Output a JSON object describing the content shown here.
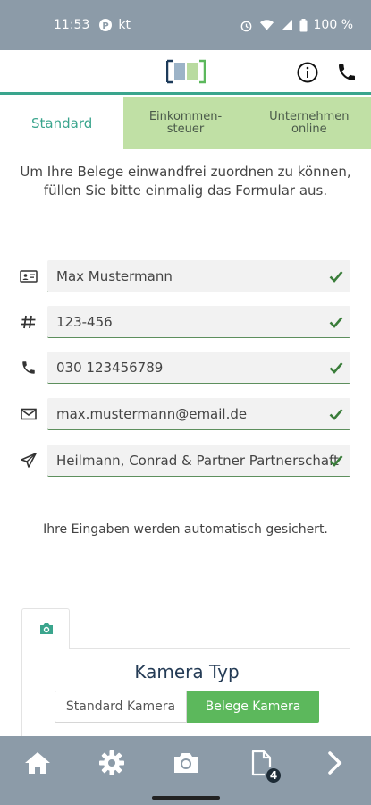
{
  "status_bar": {
    "time": "11:53",
    "carrier": "kt",
    "battery": "100 %"
  },
  "tabs": [
    {
      "label": "Standard",
      "active": true
    },
    {
      "line1": "Einkommen-",
      "line2": "steuer",
      "active": false
    },
    {
      "line1": "Unternehmen",
      "line2": "online",
      "active": false
    }
  ],
  "intro_text": "Um Ihre Belege einwandfrei zuordnen zu können, füllen Sie bitte einmalig das Formular aus.",
  "form_fields": [
    {
      "icon": "id-card-icon",
      "value": "Max Mustermann",
      "valid": true
    },
    {
      "icon": "hash-icon",
      "value": "123-456",
      "valid": true
    },
    {
      "icon": "phone-icon",
      "value": "030 123456789",
      "valid": true
    },
    {
      "icon": "mail-icon",
      "value": "max.mustermann@email.de",
      "valid": true
    },
    {
      "icon": "send-icon",
      "value": "Heilmann, Conrad & Partner Partnerschaft",
      "valid": true
    }
  ],
  "autosave_text": "Ihre Eingaben werden automatisch gesichert.",
  "camera": {
    "title": "Kamera Typ",
    "options": [
      "Standard Kamera",
      "Belege Kamera"
    ],
    "selected": "Belege Kamera"
  },
  "bottom_nav": {
    "items": [
      "home-icon",
      "gear-icon",
      "camera-icon",
      "document-icon",
      "chevron-right-icon"
    ],
    "documents_badge": "4"
  },
  "colors": {
    "accent": "#3aa58d",
    "tab_inactive": "#c0e0a5",
    "bars": "#8c9ba8",
    "button_green": "#5cb85c"
  }
}
